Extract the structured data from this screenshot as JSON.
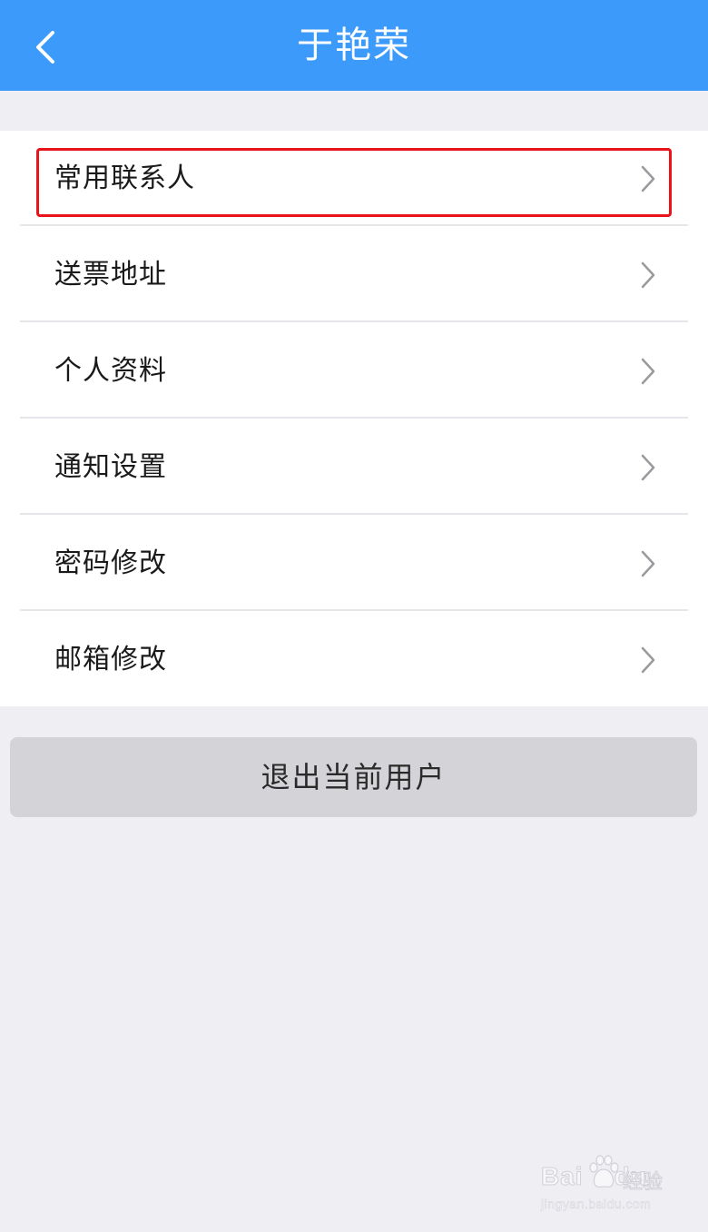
{
  "header": {
    "title": "于艳荣",
    "back_icon": "chevron-left-icon",
    "background_color": "#3c9bfa"
  },
  "menu": {
    "items": [
      {
        "label": "常用联系人",
        "icon": "chevron-right-icon",
        "highlighted": true
      },
      {
        "label": "送票地址",
        "icon": "chevron-right-icon"
      },
      {
        "label": "个人资料",
        "icon": "chevron-right-icon"
      },
      {
        "label": "通知设置",
        "icon": "chevron-right-icon"
      },
      {
        "label": "密码修改",
        "icon": "chevron-right-icon"
      },
      {
        "label": "邮箱修改",
        "icon": "chevron-right-icon"
      }
    ],
    "highlight_color": "#e8141a"
  },
  "logout": {
    "label": "退出当前用户"
  },
  "watermark": {
    "brand": "Bai",
    "brand_suffix": "du",
    "text": "经验",
    "url": "jingyan.baidu.com"
  }
}
